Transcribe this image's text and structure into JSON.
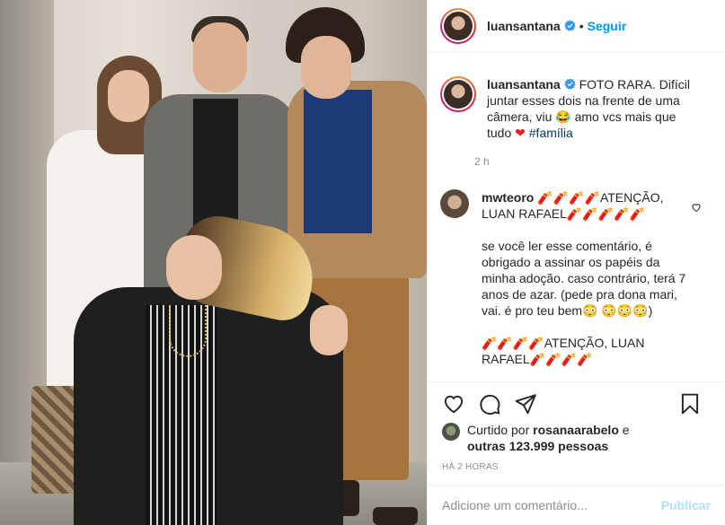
{
  "post": {
    "username": "luansantana",
    "follow_label": "Seguir",
    "dot": "•"
  },
  "caption": {
    "username": "luansantana",
    "text": "FOTO RARA. Difícil juntar esses dois na frente de uma câmera, viu 😂 amo vcs mais que tudo ",
    "heart": "❤",
    "hashtag": "#família",
    "time": "2 h"
  },
  "comment": {
    "username": "mwteoro",
    "line1": "🧨🧨🧨🧨ATENÇÃO, LUAN RAFAEL🧨🧨🧨🧨🧨",
    "line2": "se você ler esse comentário, é obrigado a assinar os papéis da minha adoção. caso contrário, terá 7 anos de azar. (pede pra dona mari, vai. é pro teu bem😳 😳😳😳)",
    "line3": "🧨🧨🧨🧨ATENÇÃO, LUAN RAFAEL🧨🧨🧨🧨"
  },
  "likes": {
    "prefix": "Curtido por ",
    "user": "rosanaarabelo",
    "middle": " e ",
    "others": "outras 123.999 pessoas"
  },
  "time_ago": "HÁ 2 HORAS",
  "add_comment": {
    "placeholder": "Adicione um comentário...",
    "publish_label": "Publicar"
  },
  "icons": [
    "heart-icon",
    "comment-icon",
    "share-icon",
    "bookmark-icon",
    "verified-icon"
  ],
  "colors": {
    "link": "#0095f6",
    "hashtag": "#00376b",
    "muted": "#8e8e8e",
    "publish_disabled": "#b2dffc",
    "border": "#efefef"
  }
}
